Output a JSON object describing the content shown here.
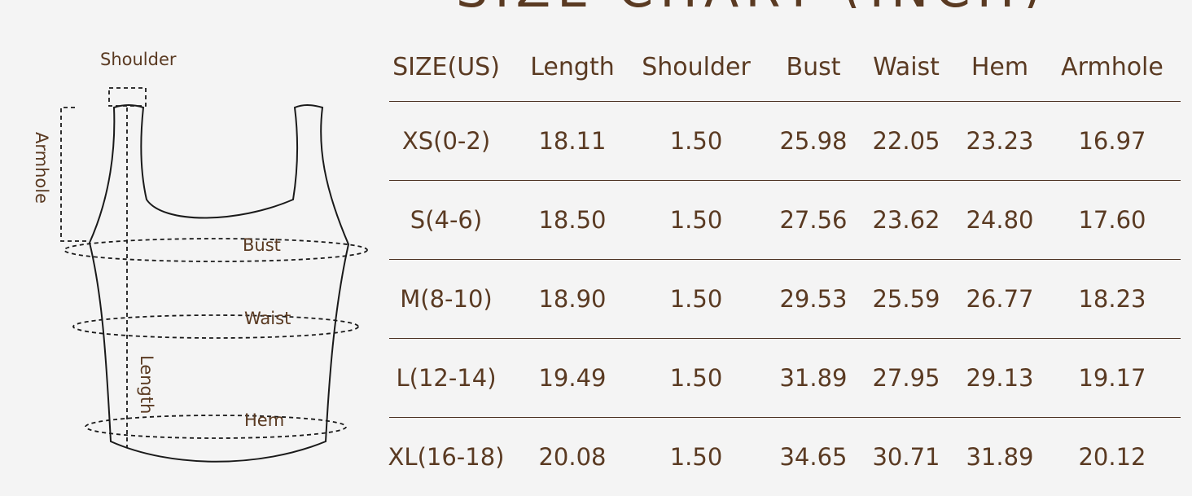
{
  "title": "SIZE CHART (INCH)",
  "diagram": {
    "labels": {
      "shoulder": "Shoulder",
      "armhole": "Armhole",
      "bust": "Bust",
      "waist": "Waist",
      "length": "Length",
      "hem": "Hem"
    }
  },
  "table": {
    "headers": [
      "SIZE(US)",
      "Length",
      "Shoulder",
      "Bust",
      "Waist",
      "Hem",
      "Armhole"
    ],
    "rows": [
      [
        "XS(0-2)",
        "18.11",
        "1.50",
        "25.98",
        "22.05",
        "23.23",
        "16.97"
      ],
      [
        "S(4-6)",
        "18.50",
        "1.50",
        "27.56",
        "23.62",
        "24.80",
        "17.60"
      ],
      [
        "M(8-10)",
        "18.90",
        "1.50",
        "29.53",
        "25.59",
        "26.77",
        "18.23"
      ],
      [
        "L(12-14)",
        "19.49",
        "1.50",
        "31.89",
        "27.95",
        "29.13",
        "19.17"
      ],
      [
        "XL(16-18)",
        "20.08",
        "1.50",
        "34.65",
        "30.71",
        "31.89",
        "20.12"
      ]
    ]
  },
  "colors": {
    "text": "#5a3a22",
    "line": "#4a3020",
    "background": "#f4f4f4"
  }
}
